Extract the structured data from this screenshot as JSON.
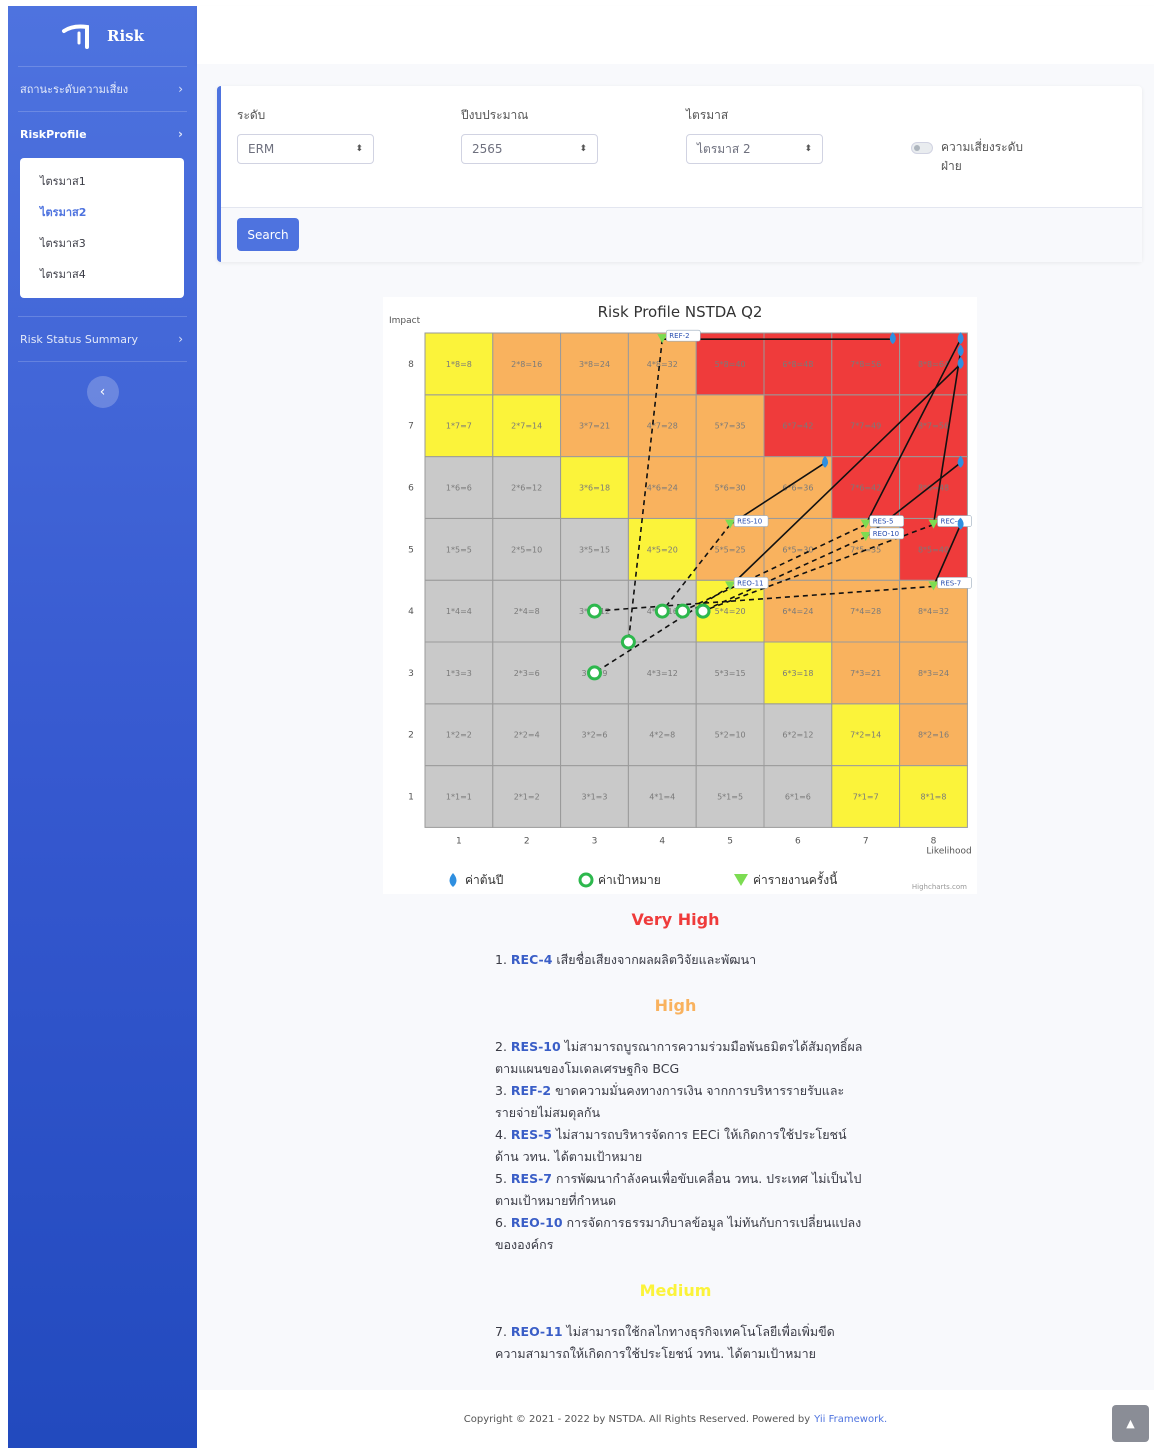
{
  "sidebar": {
    "brand": "Risk",
    "items": [
      {
        "label": "สถานะระดับความเสี่ยง"
      },
      {
        "label": "RiskProfile"
      },
      {
        "label": "Risk Status Summary"
      }
    ],
    "submenu": [
      "ไตรมาส1",
      "ไตรมาส2",
      "ไตรมาส3",
      "ไตรมาส4"
    ],
    "toggle_icon": "chevron-left-icon"
  },
  "filters": {
    "level_label": "ระดับ",
    "level_value": "ERM",
    "year_label": "ปีงบประมาณ",
    "year_value": "2565",
    "quarter_label": "ไตรมาส",
    "quarter_value": "ไตรมาส 2",
    "switch_label": "ความเสี่ยงระดับฝ่าย",
    "search_label": "Search"
  },
  "colors": {
    "very_high": "#ef3b3b",
    "high": "#f9b25e",
    "medium": "#fbf33a",
    "low": "#c9c9c9",
    "series_start": "#2f8fe0",
    "series_target": "#2db84d",
    "series_report": "#7cdc52"
  },
  "chart_data": {
    "type": "scatter",
    "title": "Risk Profile NSTDA Q2",
    "xlabel": "Likelihood",
    "ylabel": "Impact",
    "xlim": [
      1,
      8
    ],
    "ylim": [
      1,
      8
    ],
    "x_ticks": [
      "1",
      "2",
      "3",
      "4",
      "5",
      "6",
      "7",
      "8"
    ],
    "y_ticks": [
      "1",
      "2",
      "3",
      "4",
      "5",
      "6",
      "7",
      "8"
    ],
    "grid_colors": [
      [
        "low",
        "low",
        "low",
        "low",
        "low",
        "low",
        "medium",
        "medium"
      ],
      [
        "low",
        "low",
        "low",
        "low",
        "low",
        "low",
        "medium",
        "high"
      ],
      [
        "low",
        "low",
        "low",
        "low",
        "low",
        "medium",
        "high",
        "high"
      ],
      [
        "low",
        "low",
        "low",
        "low",
        "medium",
        "high",
        "high",
        "high"
      ],
      [
        "low",
        "low",
        "low",
        "medium",
        "high",
        "high",
        "high",
        "very_high"
      ],
      [
        "low",
        "low",
        "medium",
        "high",
        "high",
        "high",
        "very_high",
        "very_high"
      ],
      [
        "medium",
        "medium",
        "high",
        "high",
        "high",
        "very_high",
        "very_high",
        "very_high"
      ],
      [
        "medium",
        "high",
        "high",
        "high",
        "very_high",
        "very_high",
        "very_high",
        "very_high"
      ]
    ],
    "legend": [
      {
        "name": "ค่าต้นปี",
        "icon": "water-drop-icon"
      },
      {
        "name": "ค่าเป้าหมาย",
        "icon": "target-circle-icon"
      },
      {
        "name": "ค่ารายงานครั้งนี้",
        "icon": "triangle-down-icon"
      }
    ],
    "risks": [
      {
        "code": "REF-2",
        "start": [
          7.4,
          8.4
        ],
        "target": [
          3.5,
          3.5
        ],
        "report": [
          4.0,
          8.4
        ]
      },
      {
        "code": "RES-10",
        "start": [
          6.4,
          6.4
        ],
        "target": [
          4.0,
          4.0
        ],
        "report": [
          5.0,
          5.4
        ]
      },
      {
        "code": "RES-5",
        "start": [
          8.4,
          8.4
        ],
        "target": [
          4.3,
          4.0
        ],
        "report": [
          7.0,
          5.4
        ]
      },
      {
        "code": "REO-10",
        "start": [
          8.4,
          6.4
        ],
        "target": [
          4.6,
          4.0
        ],
        "report": [
          7.0,
          5.2
        ]
      },
      {
        "code": "REC-4",
        "start": [
          8.4,
          8.2
        ],
        "target": [
          4.6,
          4.0
        ],
        "report": [
          8.0,
          5.4
        ]
      },
      {
        "code": "RES-7",
        "start": [
          8.4,
          5.4
        ],
        "target": [
          3.0,
          4.0
        ],
        "report": [
          8.0,
          4.4
        ]
      },
      {
        "code": "REO-11",
        "start": [
          8.4,
          8.0
        ],
        "target": [
          3.0,
          3.0
        ],
        "report": [
          5.0,
          4.4
        ]
      }
    ],
    "credits": "Highcharts.com"
  },
  "summary": {
    "very_high_title": "Very High",
    "very_high": [
      {
        "no": "1.",
        "code": "REC-4",
        "text": "เสียชื่อเสียงจากผลผลิตวิจัยและพัฒนา"
      }
    ],
    "high_title": "High",
    "high": [
      {
        "no": "2.",
        "code": "RES-10",
        "text": "ไม่สามารถบูรณาการความร่วมมือพันธมิตรได้สัมฤทธิ์ผลตามแผนของโมเดลเศรษฐกิจ BCG"
      },
      {
        "no": "3.",
        "code": "REF-2",
        "text": "ขาดความมั่นคงทางการเงิน จากการบริหารรายรับและรายจ่ายไม่สมดุลกัน"
      },
      {
        "no": "4.",
        "code": "RES-5",
        "text": "ไม่สามารถบริหารจัดการ EECi ให้เกิดการใช้ประโยชน์ด้าน วทน. ได้ตามเป้าหมาย"
      },
      {
        "no": "5.",
        "code": "RES-7",
        "text": "การพัฒนากำลังคนเพื่อขับเคลื่อน วทน. ประเทศ ไม่เป็นไปตามเป้าหมายที่กำหนด"
      },
      {
        "no": "6.",
        "code": "REO-10",
        "text": "การจัดการธรรมาภิบาลข้อมูล ไม่ทันกับการเปลี่ยนแปลงขององค์กร"
      }
    ],
    "medium_title": "Medium",
    "medium": [
      {
        "no": "7.",
        "code": "REO-11",
        "text": "ไม่สามารถใช้กลไกทางธุรกิจเทคโนโลยีเพื่อเพิ่มขีดความสามารถให้เกิดการใช้ประโยชน์ วทน. ได้ตามเป้าหมาย"
      }
    ]
  },
  "footer": {
    "text": "Copyright © 2021 - 2022 by NSTDA. All Rights Reserved. Powered by",
    "link": "Yii Framework."
  }
}
